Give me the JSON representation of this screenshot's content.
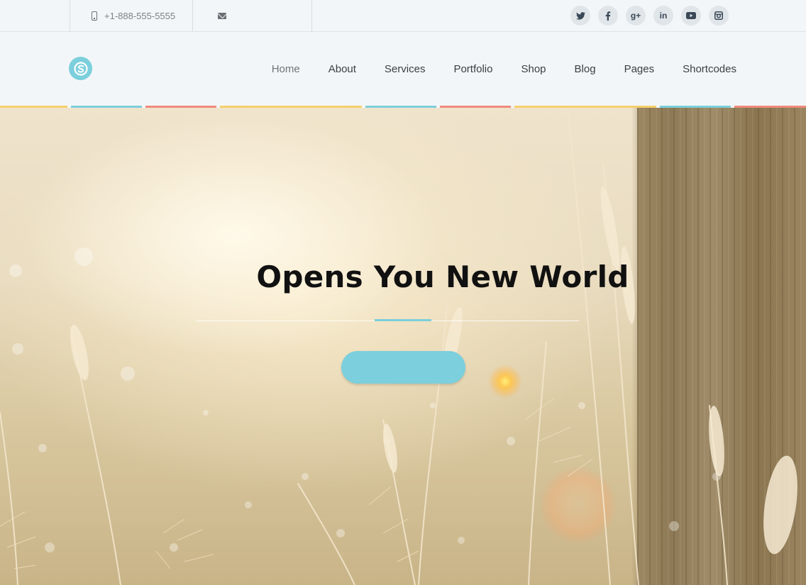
{
  "topbar": {
    "phone_icon": "mobile-phone-icon",
    "phone": "+1-888-555-5555",
    "mail_icon": "envelope-icon",
    "socials": [
      "twitter-icon",
      "facebook-icon",
      "google-plus-icon",
      "linkedin-icon",
      "youtube-icon",
      "instagram-icon"
    ]
  },
  "header": {
    "logo_icon": "site-logo-s-icon",
    "nav": [
      "Home",
      "About",
      "Services",
      "Portfolio",
      "Shop",
      "Blog",
      "Pages",
      "Shortcodes"
    ],
    "active_nav": "Home"
  },
  "hero": {
    "title": "Opens You New World",
    "button_label": ""
  },
  "colors": {
    "accent": "#7ccfdc",
    "strip_yellow": "#f5cf6b",
    "strip_cyan": "#7ccfdc",
    "strip_coral": "#ef8a7c",
    "icon_dark": "#3a4856",
    "background": "#f3f6f8"
  }
}
